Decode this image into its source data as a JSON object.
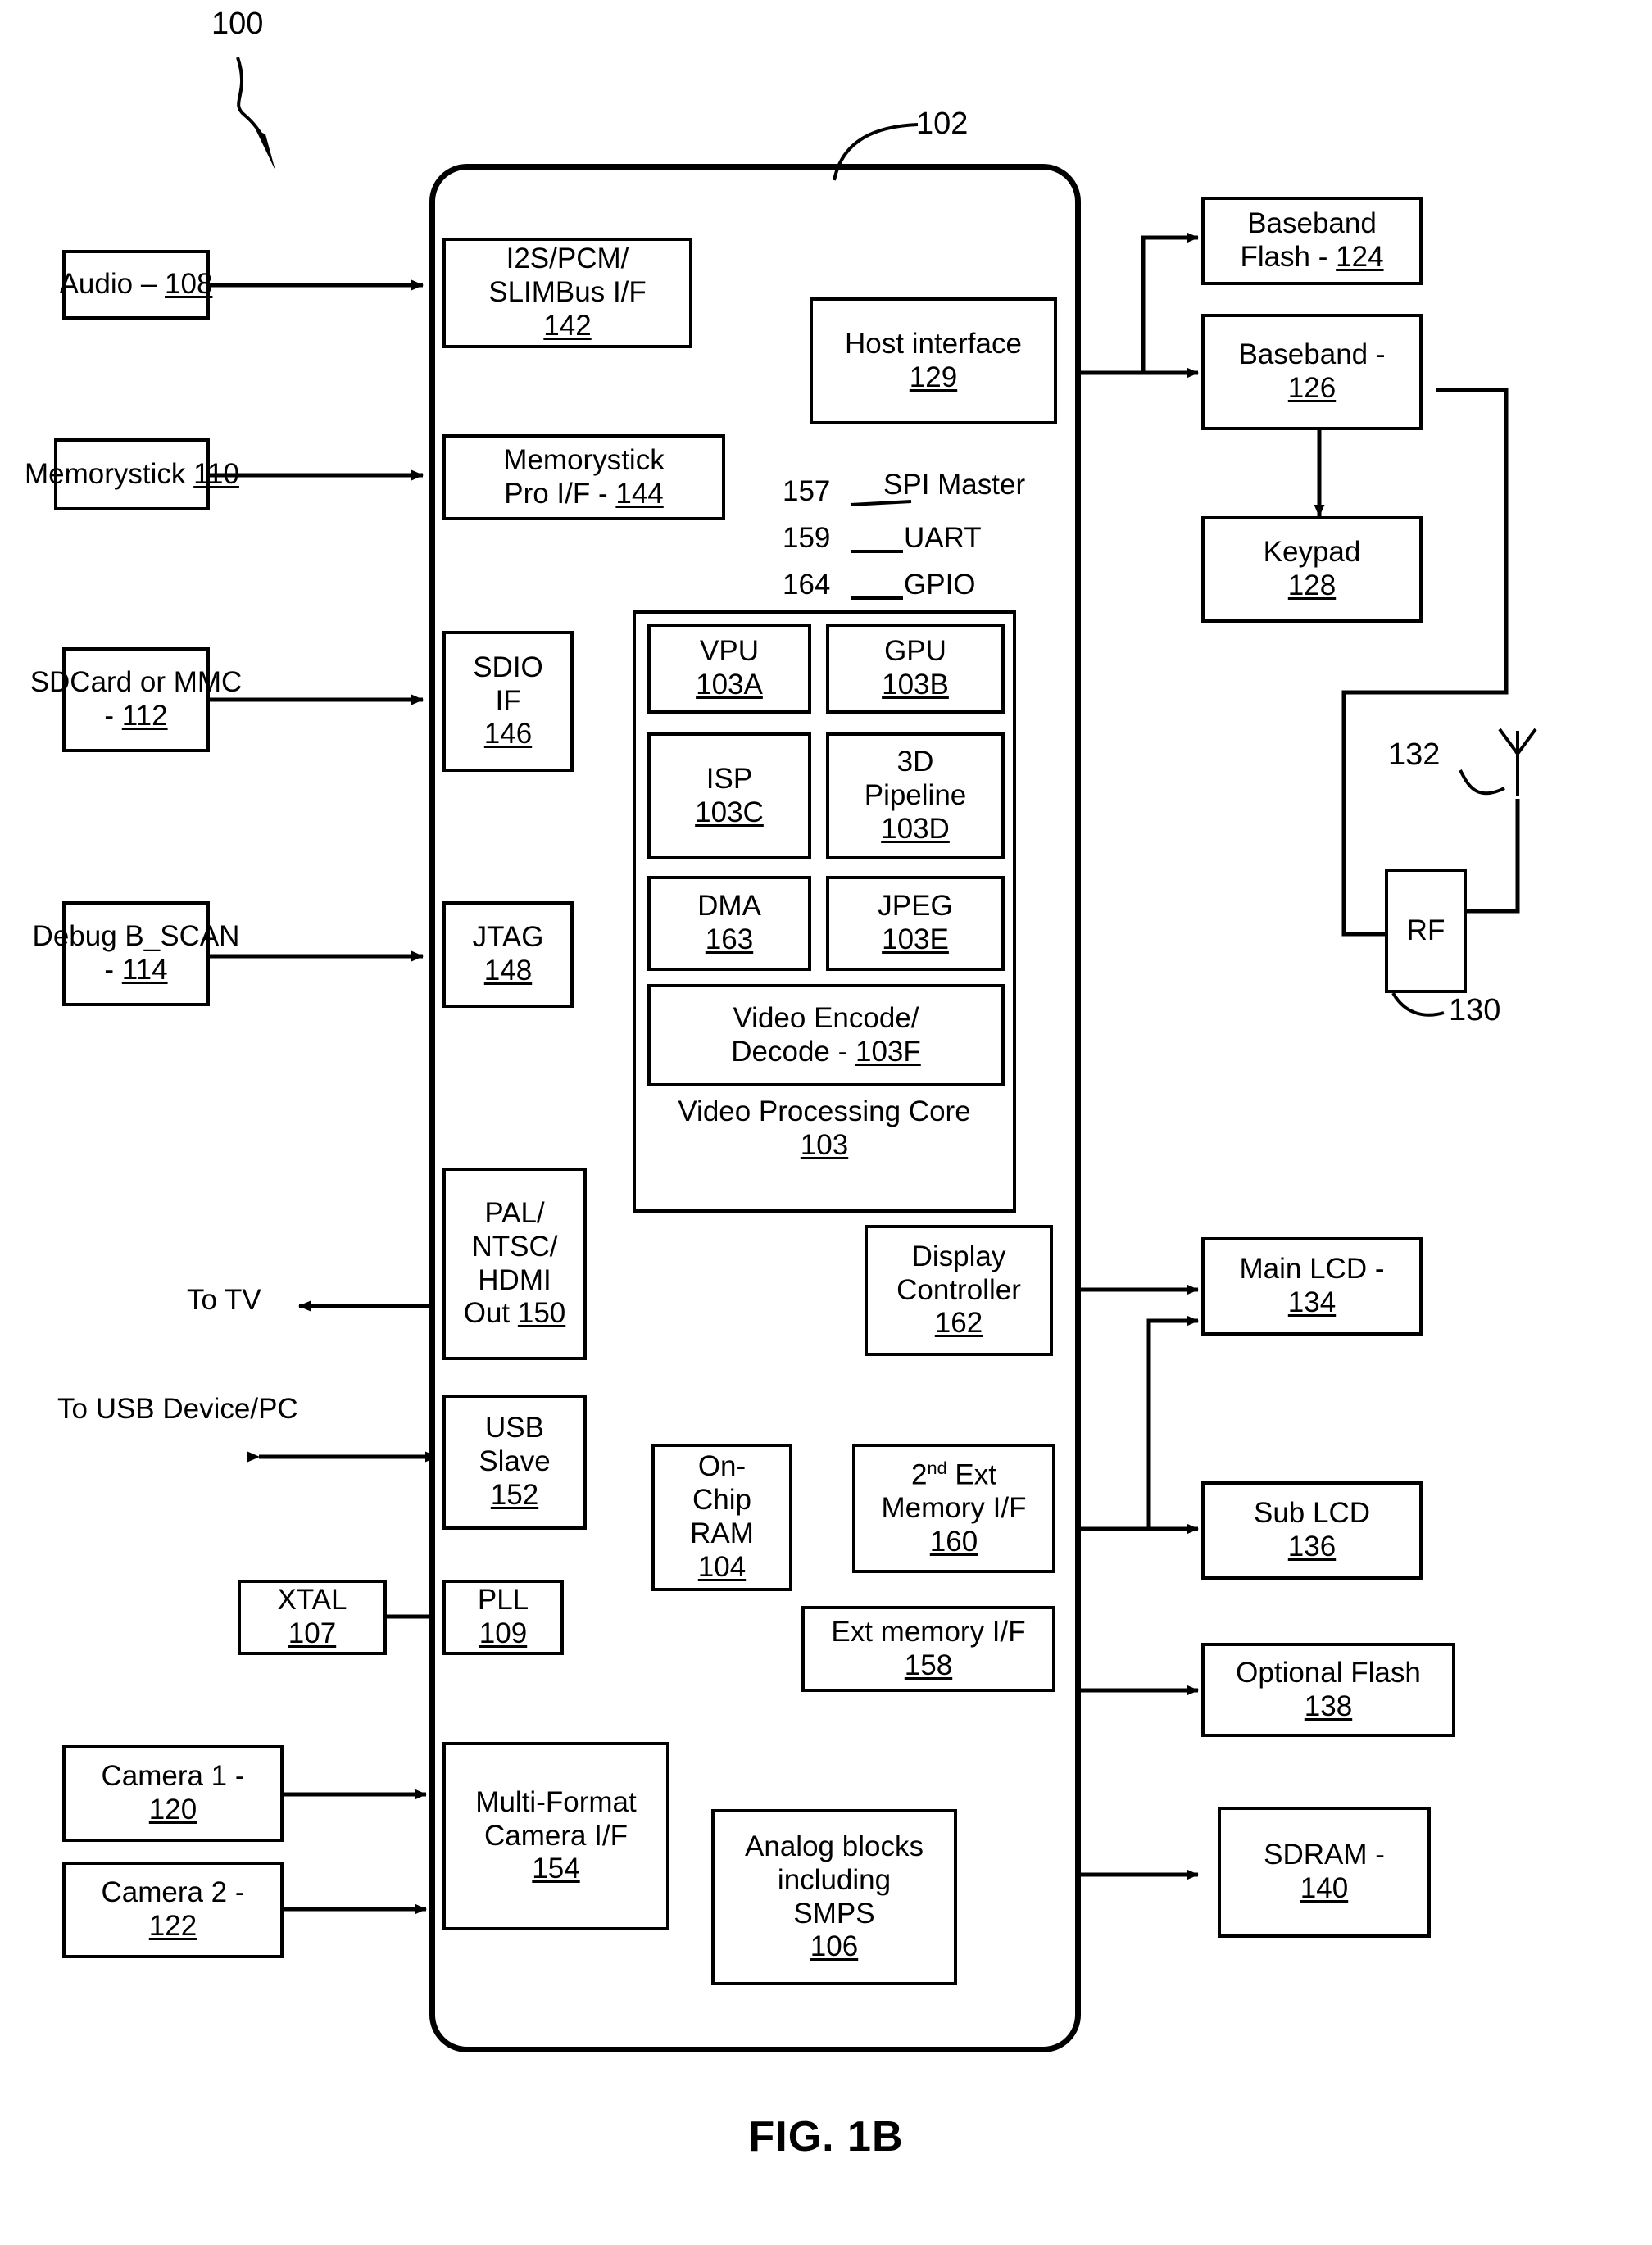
{
  "figure": {
    "caption": "FIG. 1B",
    "system_ref": "100",
    "chip_ref": "102"
  },
  "chip": {
    "label": "102"
  },
  "external_blocks": [
    {
      "name": "audio",
      "lines": [
        "Audio – ",
        "108"
      ],
      "ref": "108"
    },
    {
      "name": "memorystick",
      "lines": [
        "Memorystick ",
        "110"
      ],
      "ref": "110"
    },
    {
      "name": "sdcard-mmc",
      "lines": [
        "SDCard or MMC",
        "- ",
        "112"
      ],
      "ref": "112"
    },
    {
      "name": "debug-bscan",
      "lines": [
        "Debug B_SCAN",
        "- ",
        "114"
      ],
      "ref": "114"
    },
    {
      "name": "camera-1",
      "lines": [
        "Camera 1 -",
        "120"
      ],
      "ref": "120"
    },
    {
      "name": "camera-2",
      "lines": [
        "Camera 2 -",
        "122"
      ],
      "ref": "122"
    },
    {
      "name": "baseband-flash",
      "lines": [
        "Baseband",
        "Flash - ",
        "124"
      ],
      "ref": "124"
    },
    {
      "name": "baseband",
      "lines": [
        "Baseband -",
        "126"
      ],
      "ref": "126"
    },
    {
      "name": "keypad",
      "lines": [
        "Keypad",
        "128"
      ],
      "ref": "128"
    },
    {
      "name": "rf",
      "lines": [
        "RF"
      ],
      "ref": "130"
    },
    {
      "name": "main-lcd",
      "lines": [
        "Main LCD -",
        "134"
      ],
      "ref": "134"
    },
    {
      "name": "sub-lcd",
      "lines": [
        "Sub LCD",
        "136"
      ],
      "ref": "136"
    },
    {
      "name": "optional-flash",
      "lines": [
        "Optional Flash",
        "138"
      ],
      "ref": "138"
    },
    {
      "name": "sdram",
      "lines": [
        "SDRAM -",
        "140"
      ],
      "ref": "140"
    },
    {
      "name": "xtal",
      "lines": [
        "XTAL",
        "107"
      ],
      "ref": "107"
    }
  ],
  "blocks": {
    "audio": {
      "l1": "Audio – ",
      "ref": "108"
    },
    "memorystick": {
      "l1": "Memorystick ",
      "ref": "110"
    },
    "sdcard": {
      "l1": "SDCard or MMC",
      "l2": "- ",
      "ref": "112"
    },
    "debug": {
      "l1": "Debug B_SCAN",
      "l2": "- ",
      "ref": "114"
    },
    "camera1": {
      "l1": "Camera 1 -",
      "ref": "120"
    },
    "camera2": {
      "l1": "Camera 2 -",
      "ref": "122"
    },
    "baseband_flash": {
      "l1": "Baseband",
      "l2": "Flash - ",
      "ref": "124"
    },
    "baseband": {
      "l1": "Baseband -",
      "ref": "126"
    },
    "keypad": {
      "l1": "Keypad",
      "ref": "128"
    },
    "rf": {
      "l1": "RF",
      "ref": "130"
    },
    "antenna": {
      "ref": "132"
    },
    "main_lcd": {
      "l1": "Main LCD -",
      "ref": "134"
    },
    "sub_lcd": {
      "l1": "Sub LCD",
      "ref": "136"
    },
    "optional_flash": {
      "l1": "Optional Flash",
      "ref": "138"
    },
    "sdram": {
      "l1": "SDRAM -",
      "ref": "140"
    },
    "xtal": {
      "l1": "XTAL",
      "ref": "107"
    },
    "pll": {
      "l1": "PLL",
      "ref": "109"
    },
    "i2s": {
      "l1": "I2S/PCM/",
      "l2": "SLIMBus I/F",
      "ref": "142"
    },
    "memorystick_if": {
      "l1": "Memorystick",
      "l2": "Pro I/F - ",
      "ref": "144"
    },
    "sdio": {
      "l1": "SDIO",
      "l2": "IF",
      "ref": "146"
    },
    "jtag": {
      "l1": "JTAG",
      "ref": "148"
    },
    "pal": {
      "l1": "PAL/",
      "l2": "NTSC/",
      "l3": "HDMI",
      "l4": "Out ",
      "ref": "150"
    },
    "usb": {
      "l1": "USB",
      "l2": "Slave",
      "ref": "152"
    },
    "camera_if": {
      "l1": "Multi-Format",
      "l2": "Camera I/F",
      "ref": "154"
    },
    "host_if": {
      "l1": "Host interface",
      "ref": "129"
    },
    "onchip_ram": {
      "l1": "On-",
      "l2": "Chip",
      "l3": "RAM",
      "ref": "104"
    },
    "ext_mem_2": {
      "l1_a": "2",
      "l1_sup": "nd",
      "l1_b": " Ext",
      "l2": "Memory I/F",
      "ref": "160"
    },
    "ext_mem": {
      "l1": "Ext memory I/F",
      "ref": "158"
    },
    "display_ctrl": {
      "l1": "Display",
      "l2": "Controller",
      "ref": "162"
    },
    "analog": {
      "l1": "Analog blocks",
      "l2": "including",
      "l3": "SMPS",
      "ref": "106"
    }
  },
  "vpc": {
    "title": "Video Processing Core",
    "ref": "103",
    "cells": [
      {
        "name": "vpu",
        "l1": "VPU",
        "ref": "103A"
      },
      {
        "name": "gpu",
        "l1": "GPU",
        "ref": "103B"
      },
      {
        "name": "isp",
        "l1": "ISP",
        "ref": "103C"
      },
      {
        "name": "3d-pipeline",
        "l1": "3D",
        "l2": "Pipeline",
        "ref": "103D"
      },
      {
        "name": "dma",
        "l1": "DMA",
        "ref": "163"
      },
      {
        "name": "jpeg",
        "l1": "JPEG",
        "ref": "103E"
      },
      {
        "name": "video-codec",
        "l1": "Video Encode/",
        "l2": "Decode - ",
        "ref": "103F"
      }
    ]
  },
  "legend": [
    {
      "num": "157",
      "label": "SPI Master"
    },
    {
      "num": "159",
      "label": "UART"
    },
    {
      "num": "164",
      "label": "GPIO"
    }
  ],
  "free_text": {
    "to_tv": "To TV",
    "to_usb": "To USB Device/PC"
  }
}
